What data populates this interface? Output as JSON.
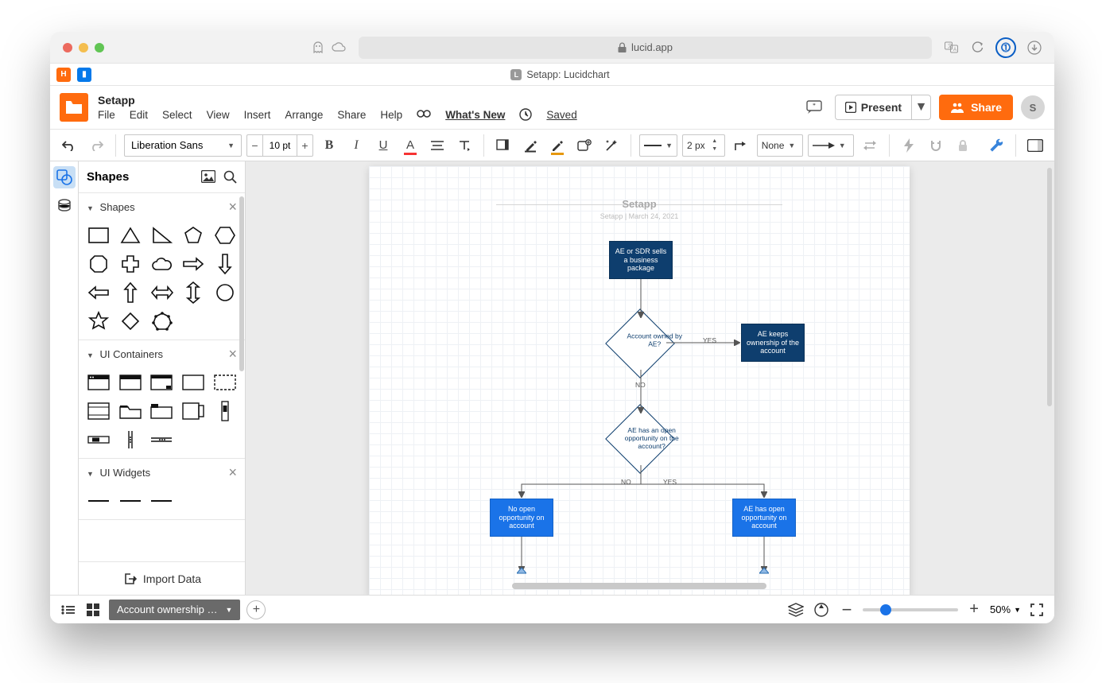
{
  "browser": {
    "url_domain": "lucid.app",
    "tab_title": "Setapp: Lucidchart",
    "tab_favicon": "L",
    "left_icons": [
      {
        "bg": "#ff6b0e",
        "txt": "H"
      },
      {
        "bg": "#0579ea",
        "txt": "▮"
      }
    ]
  },
  "app": {
    "doc_title": "Setapp",
    "menus": [
      "File",
      "Edit",
      "Select",
      "View",
      "Insert",
      "Arrange",
      "Share",
      "Help"
    ],
    "whats_new": "What's New",
    "saved": "Saved",
    "present": "Present",
    "share": "Share",
    "avatar": "S"
  },
  "toolbar": {
    "font_name": "Liberation Sans",
    "font_size": "10 pt",
    "line_width": "2 px",
    "line_end_default": "None"
  },
  "panel": {
    "title": "Shapes",
    "sections": {
      "shapes": "Shapes",
      "ui_containers": "UI Containers",
      "ui_widgets": "UI Widgets"
    },
    "import": "Import Data"
  },
  "canvas": {
    "title": "Setapp",
    "subtitle": "Setapp   |   March 24, 2021",
    "nodes": {
      "start": "AE or SDR sells a business package",
      "d1": "Account owned by AE?",
      "d1_right": "AE keeps ownership of the account",
      "d2": "AE has an open opportunity on the account?",
      "r_left": "No open opportunity on account",
      "r_right": "AE has open opportunity on account"
    },
    "labels": {
      "yes": "YES",
      "no": "NO"
    }
  },
  "footer": {
    "page_tab": "Account ownership …",
    "zoom": "50%"
  }
}
